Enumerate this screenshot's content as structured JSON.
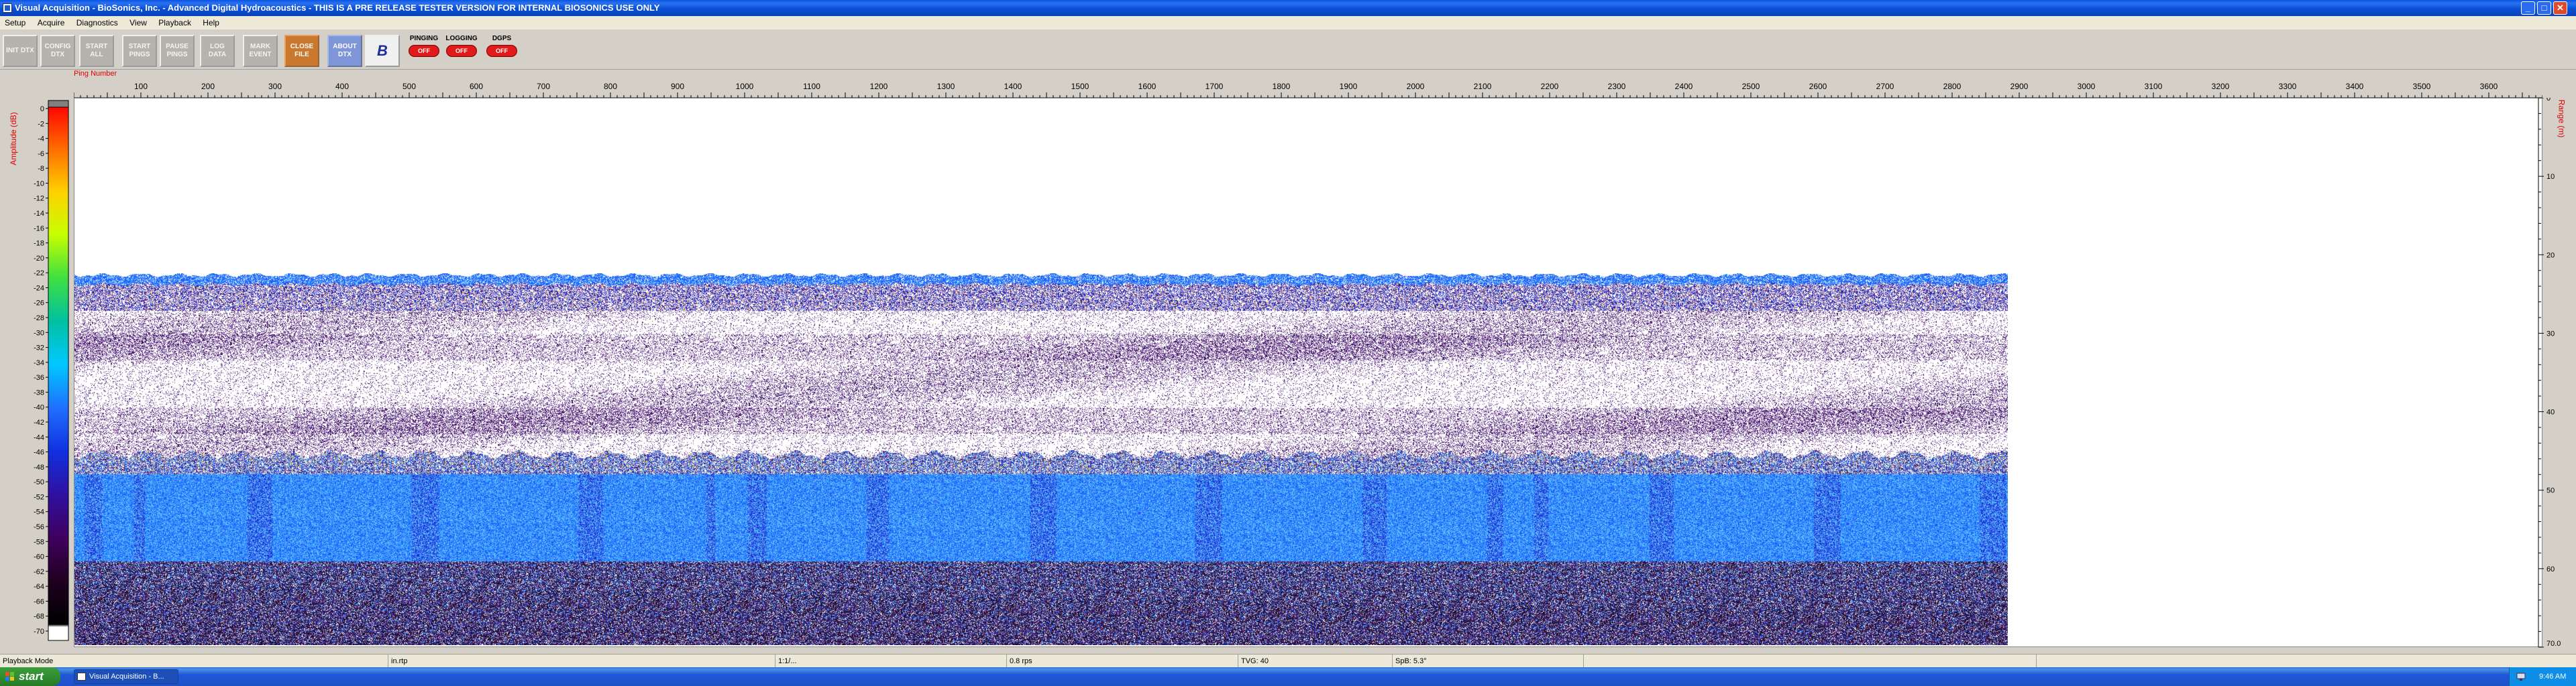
{
  "window": {
    "title": "Visual Acquisition  -  BioSonics, Inc.  -  Advanced Digital Hydroacoustics  -  THIS IS A PRE RELEASE TESTER VERSION FOR INTERNAL BIOSONICS USE ONLY",
    "min_glyph": "_",
    "max_glyph": "□",
    "close_glyph": "✕"
  },
  "menu": [
    "Setup",
    "Acquire",
    "Diagnostics",
    "View",
    "Playback",
    "Help"
  ],
  "toolbar": {
    "buttons": [
      {
        "label": "INIT DTX",
        "style": "gray"
      },
      {
        "label": "CONFIG DTX",
        "style": "gray"
      },
      {
        "label": "START ALL",
        "style": "gray"
      },
      {
        "label": "START PINGS",
        "style": "gray"
      },
      {
        "label": "PAUSE PINGS",
        "style": "gray"
      },
      {
        "label": "LOG DATA",
        "style": "gray"
      },
      {
        "label": "MARK EVENT",
        "style": "gray"
      },
      {
        "label": "CLOSE FILE",
        "style": "orange"
      },
      {
        "label": "ABOUT DTX",
        "style": "blue"
      },
      {
        "label": "B",
        "style": "logo"
      }
    ],
    "indicators": [
      {
        "label": "PINGING",
        "state": "OFF"
      },
      {
        "label": "LOGGING",
        "state": "OFF"
      },
      {
        "label": "DGPS",
        "state": "OFF"
      }
    ]
  },
  "echogram": {
    "ping_axis_label": "Ping Number",
    "ping_ticks": [
      100,
      200,
      300,
      400,
      500,
      600,
      700,
      800,
      900,
      1000,
      1100,
      1200,
      1300,
      1400,
      1500,
      1600,
      1700,
      1800,
      1900,
      2000,
      2100,
      2200,
      2300,
      2400,
      2500,
      2600,
      2700,
      2800,
      2900,
      3000,
      3100,
      3200,
      3300,
      3400,
      3500,
      3600
    ],
    "ping_range": [
      0,
      3680
    ],
    "range_axis_label": "Range (m)",
    "range_ticks": [
      "0",
      "10",
      "20",
      "30",
      "40",
      "50",
      "60",
      "70.0"
    ],
    "range_max": 70,
    "amplitude_label": "Amplitude (dB)",
    "amplitude_ticks": [
      0,
      -2,
      -4,
      -6,
      -8,
      -10,
      -12,
      -14,
      -16,
      -18,
      -20,
      -22,
      -24,
      -26,
      -28,
      -30,
      -32,
      -34,
      -36,
      -38,
      -40,
      -42,
      -44,
      -46,
      -48,
      -50,
      -52,
      -54,
      -56,
      -58,
      -60,
      -62,
      -64,
      -66,
      -68,
      -70
    ],
    "data_extent_pings": 2880,
    "colors": {
      "scale_top": "#ff0000",
      "scale_bottom": "#000000",
      "echo_blue": "#1f4ff0",
      "echo_purple": "#5a2a8a",
      "axis_label": "#e00000"
    }
  },
  "statusbar": [
    "Playback Mode",
    "in.rtp",
    "1:1/...",
    "0.8 rps",
    "TVG: 40",
    "SpB: 5.3°"
  ],
  "taskbar": {
    "start_label": "start",
    "task_label": "Visual Acquisition - B...",
    "clock": "9:46 AM"
  }
}
